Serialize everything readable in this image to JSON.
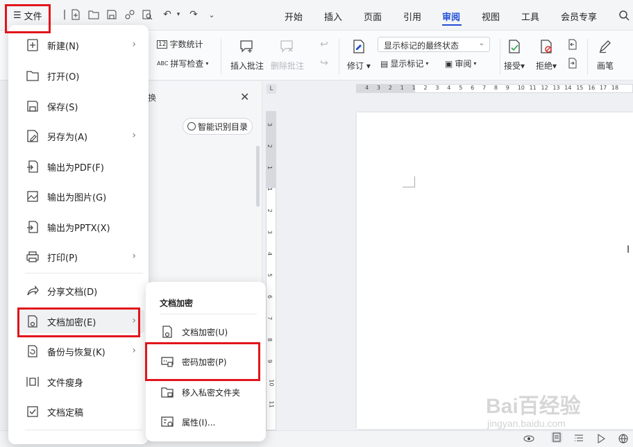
{
  "file_button": {
    "label": "文件"
  },
  "tabs": [
    {
      "label": "开始"
    },
    {
      "label": "插入"
    },
    {
      "label": "页面"
    },
    {
      "label": "引用"
    },
    {
      "label": "审阅"
    },
    {
      "label": "视图"
    },
    {
      "label": "工具"
    },
    {
      "label": "会员专享"
    }
  ],
  "active_tab": "审阅",
  "ribbon": {
    "word_count": "字数统计",
    "spell_check": "拼写检查",
    "insert_comment": "插入批注",
    "delete_comment": "删除批注",
    "revise": "修订",
    "show_markup": "显示标记",
    "review": "审阅",
    "markup_state": "显示标记的最终状态",
    "accept": "接受",
    "reject": "拒绝",
    "pen": "画笔"
  },
  "nav_pane": {
    "partial_char": "换",
    "smart_toc": "智能识别目录"
  },
  "file_menu": {
    "items": [
      {
        "label": "新建(N)",
        "submenu": true
      },
      {
        "label": "打开(O)",
        "submenu": false
      },
      {
        "label": "保存(S)",
        "submenu": false
      },
      {
        "label": "另存为(A)",
        "submenu": true
      },
      {
        "label": "输出为PDF(F)",
        "submenu": false
      },
      {
        "label": "输出为图片(G)",
        "submenu": false
      },
      {
        "label": "输出为PPTX(X)",
        "submenu": false
      },
      {
        "label": "打印(P)",
        "submenu": true
      },
      {
        "label": "分享文档(D)",
        "submenu": false
      },
      {
        "label": "文档加密(E)",
        "submenu": true
      },
      {
        "label": "备份与恢复(K)",
        "submenu": true
      },
      {
        "label": "文件瘦身",
        "submenu": false
      },
      {
        "label": "文档定稿",
        "submenu": false
      }
    ]
  },
  "encrypt_submenu": {
    "title": "文档加密",
    "items": [
      {
        "label": "文档加密(U)"
      },
      {
        "label": "密码加密(P)"
      },
      {
        "label": "移入私密文件夹"
      },
      {
        "label": "属性(I)..."
      }
    ]
  },
  "ruler": {
    "h_ticks": [
      "4",
      "3",
      "2",
      "1",
      "1",
      "2",
      "3",
      "4",
      "5",
      "6",
      "7",
      "8",
      "9",
      "10",
      "11",
      "12",
      "13",
      "14",
      "15",
      "16",
      "17",
      "18"
    ],
    "v_ticks": [
      "3",
      "2",
      "1",
      "1",
      "2",
      "3",
      "4",
      "5",
      "6",
      "7",
      "8",
      "9",
      "10",
      "11"
    ]
  },
  "watermark": {
    "text": "Bai百经验",
    "sub": "jingyan.baidu.com"
  },
  "colors": {
    "accent": "#1f4fd6",
    "highlight": "#e0151b"
  }
}
